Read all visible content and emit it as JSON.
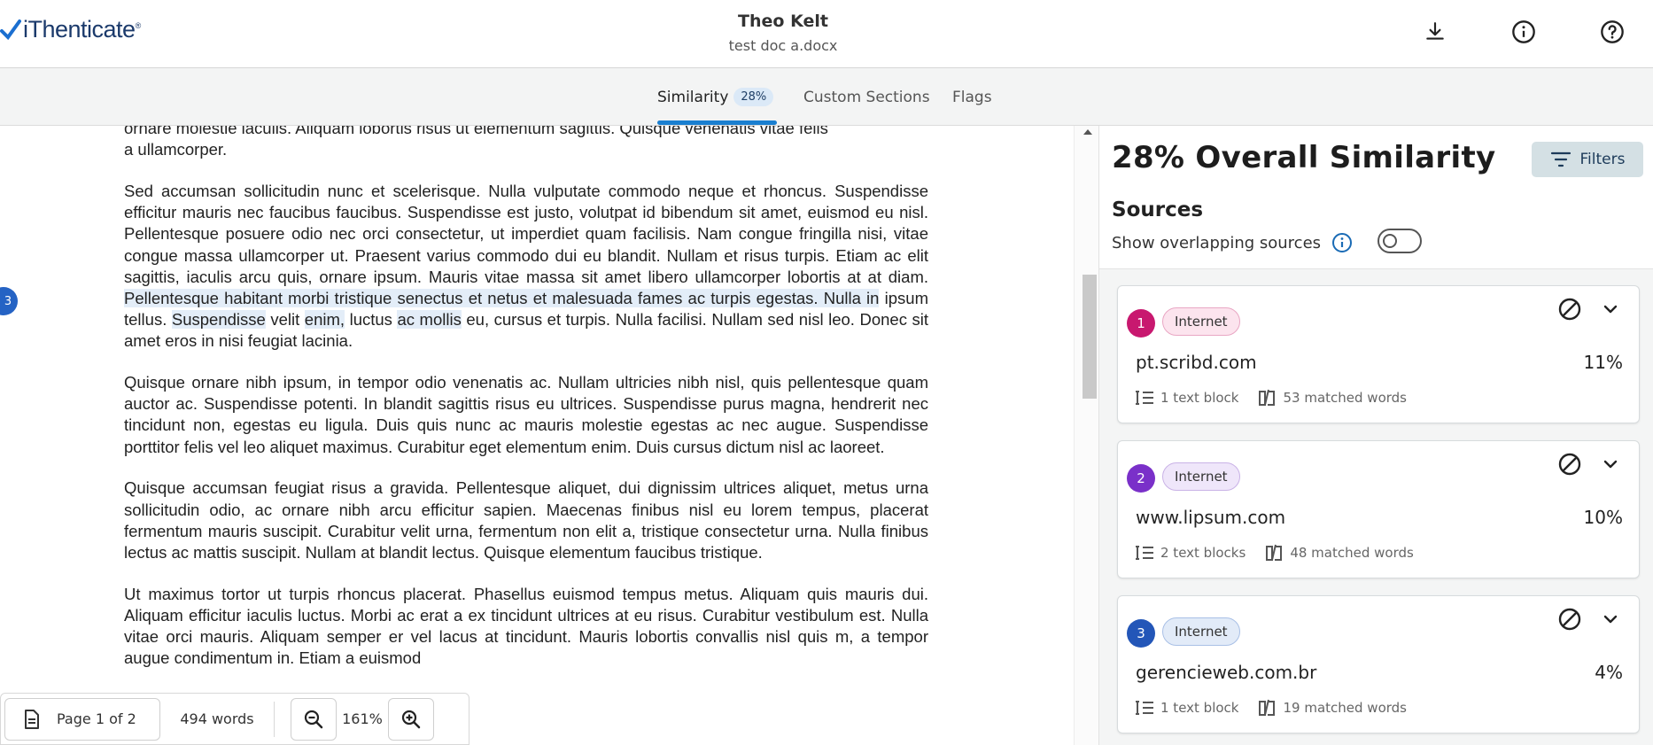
{
  "header": {
    "brand": "iThenticate",
    "brand_mark": "®",
    "owner": "Theo Kelt",
    "file_name": "test doc a.docx"
  },
  "tabs": [
    {
      "label": "Similarity",
      "badge": "28%",
      "active": true
    },
    {
      "label": "Custom Sections",
      "active": false
    },
    {
      "label": "Flags",
      "active": false
    }
  ],
  "document": {
    "marker": "3",
    "top_line_1": "ornare molestie iaculis. Aliquam lobortis risus ut elementum sagittis. Quisque venenatis vitae felis",
    "top_line_2": "a ullamcorper.",
    "p1_a": "Sed accumsan sollicitudin nunc et scelerisque. Nulla vulputate commodo neque et rhoncus. Suspendisse efficitur mauris nec faucibus faucibus. Suspendisse est justo, volutpat id bibendum sit amet, euismod eu nisl. Pellentesque posuere odio nec orci consectetur, ut imperdiet quam facilisis. Nam congue fringilla nisi, vitae congue massa ullamcorper ut. Praesent varius commodo dui eu blandit. Nullam et risus turpis. Etiam ac elit sagittis, iaculis arcu quis, ornare ipsum. Mauris vitae massa sit amet libero ullamcorper lobortis at at diam. ",
    "p1_hl1": "Pellentesque habitant morbi tristique senectus et netus et malesuada fames ac turpis egestas. Nulla in",
    "p1_b": " ipsum tellus. ",
    "p1_hl2": "Suspendisse",
    "p1_c": " velit ",
    "p1_hl3": "enim,",
    "p1_d": " luctus ",
    "p1_hl4": "ac mollis",
    "p1_e": " eu, cursus et turpis. Nulla facilisi. Nullam sed nisl leo. Donec sit amet eros in nisi feugiat lacinia.",
    "p2": "Quisque ornare nibh ipsum, in tempor odio venenatis ac. Nullam ultricies nibh nisl, quis pellentesque quam auctor ac. Suspendisse potenti. In blandit sagittis risus eu ultrices. Suspendisse purus magna, hendrerit nec tincidunt non, egestas eu ligula. Duis quis nunc ac mauris molestie egestas ac nec augue. Suspendisse porttitor felis vel leo aliquet maximus. Curabitur eget elementum enim. Duis cursus dictum nisl ac laoreet.",
    "p3": "Quisque accumsan feugiat risus a gravida. Pellentesque aliquet, dui dignissim ultrices aliquet, metus urna sollicitudin odio, ac ornare nibh arcu efficitur sapien. Maecenas finibus nisl eu lorem tempus, placerat fermentum mauris suscipit. Curabitur velit urna, fermentum non elit a, tristique consectetur urna. Nulla finibus lectus ac mattis suscipit. Nullam at blandit lectus. Quisque elementum faucibus tristique.",
    "p4": "Ut maximus tortor ut turpis rhoncus placerat. Phasellus euismod tempus metus. Aliquam quis mauris dui. Aliquam efficitur iaculis luctus. Morbi ac erat a ex tincidunt ultrices at eu risus. Curabitur vestibulum est. Nulla vitae orci mauris. Aliquam semper er vel lacus at tincidunt. Mauris lobortis convallis nisl quis m, a tempor augue condimentum in. Etiam a euismod"
  },
  "toolbar": {
    "page": "Page 1 of 2",
    "words": "494 words",
    "zoom": "161%"
  },
  "panel": {
    "overall": "28% Overall Similarity",
    "filters": "Filters",
    "sources_heading": "Sources",
    "overlap_label": "Show overlapping sources",
    "overlap_on": false
  },
  "sources": [
    {
      "num": "1",
      "type": "Internet",
      "site": "pt.scribd.com",
      "pct": "11%",
      "blocks": "1 text block",
      "matched": "53 matched words",
      "color": "#c8186f",
      "pill_bg": "#fce4ee",
      "pill_border": "#e9a7c4"
    },
    {
      "num": "2",
      "type": "Internet",
      "site": "www.lipsum.com",
      "pct": "10%",
      "blocks": "2 text blocks",
      "matched": "48 matched words",
      "color": "#7a30c9",
      "pill_bg": "#efe6fa",
      "pill_border": "#c9b2e6"
    },
    {
      "num": "3",
      "type": "Internet",
      "site": "gerencieweb.com.br",
      "pct": "4%",
      "blocks": "1 text block",
      "matched": "19 matched words",
      "color": "#2356b8",
      "pill_bg": "#e2ebf8",
      "pill_border": "#a9c0e6"
    }
  ],
  "icons": {
    "download": "download-icon",
    "info": "info-icon",
    "help": "help-icon",
    "filter": "filter-icon",
    "exclude": "exclude-icon",
    "expand": "chevron-down-icon",
    "page": "page-icon",
    "zoom_out": "zoom-out-icon",
    "zoom_in": "zoom-in-icon"
  }
}
